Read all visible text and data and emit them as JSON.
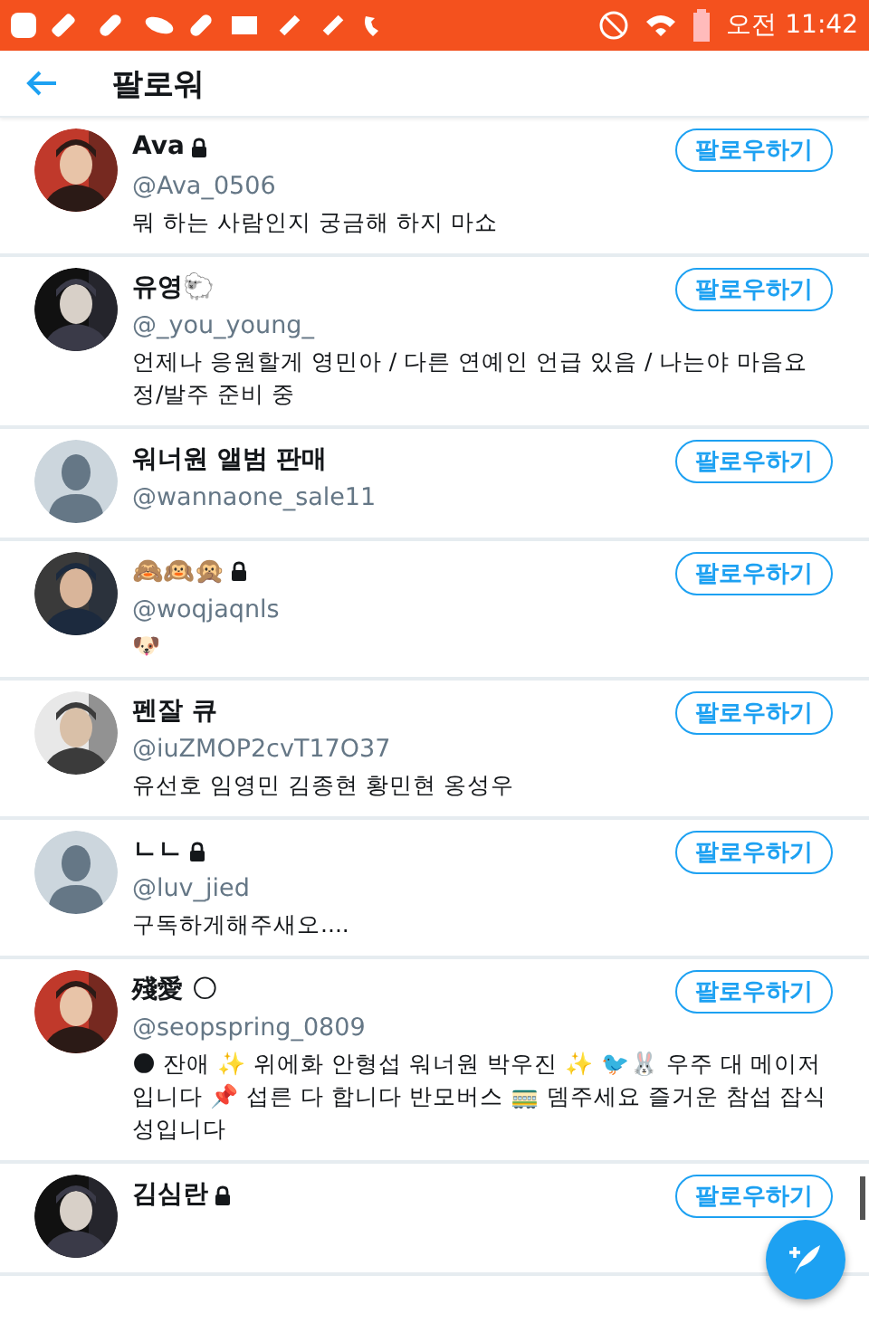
{
  "status_bar": {
    "time": "오전 11:42"
  },
  "header": {
    "title": "팔로워"
  },
  "users": [
    {
      "name": "Ava",
      "locked": true,
      "handle": "@Ava_0506",
      "bio": "뭐 하는 사람인지 궁금해 하지 마쇼",
      "button": "팔로우하기"
    },
    {
      "name": "유영🐑",
      "locked": false,
      "handle": "@_you_young_",
      "bio": "언제나 응원할게 영민아 / 다른 연예인 언급 있음 / 나는야 마음요정/발주 준비 중",
      "button": "팔로우하기"
    },
    {
      "name": "워너원 앨범 판매",
      "locked": false,
      "handle": "@wannaone_sale11",
      "avatar": {
        "kind": "default"
      },
      "button": "팔로우하기"
    },
    {
      "name": "🙈🙉🙊",
      "locked": true,
      "handle": "@woqjaqnls",
      "bio": "🐶",
      "button": "팔로우하기"
    },
    {
      "name": "펜잘 큐",
      "locked": false,
      "handle": "@iuZMOP2cvT17O37",
      "bio": "유선호 임영민 김종현 황민현 옹성우",
      "button": "팔로우하기"
    },
    {
      "name": "ㄴㄴ",
      "locked": true,
      "handle": "@luv_jied",
      "bio": "구독하게해주새오....",
      "avatar": {
        "kind": "default"
      },
      "button": "팔로우하기"
    },
    {
      "name": "殘愛 🌕",
      "locked": false,
      "handle": "@seopspring_0809",
      "bio": "🌑 잔애 ✨ 위에화 안형섭 워너원 박우진 ✨ 🐦🐰 우주 대 메이저입니다 📌 섭른 다 합니다 반모버스 🚃 뎀주세요 즐거운 참섭 잡식성입니다",
      "button": "팔로우하기"
    },
    {
      "name": "김심란",
      "locked": true,
      "button": "팔로우하기"
    }
  ]
}
